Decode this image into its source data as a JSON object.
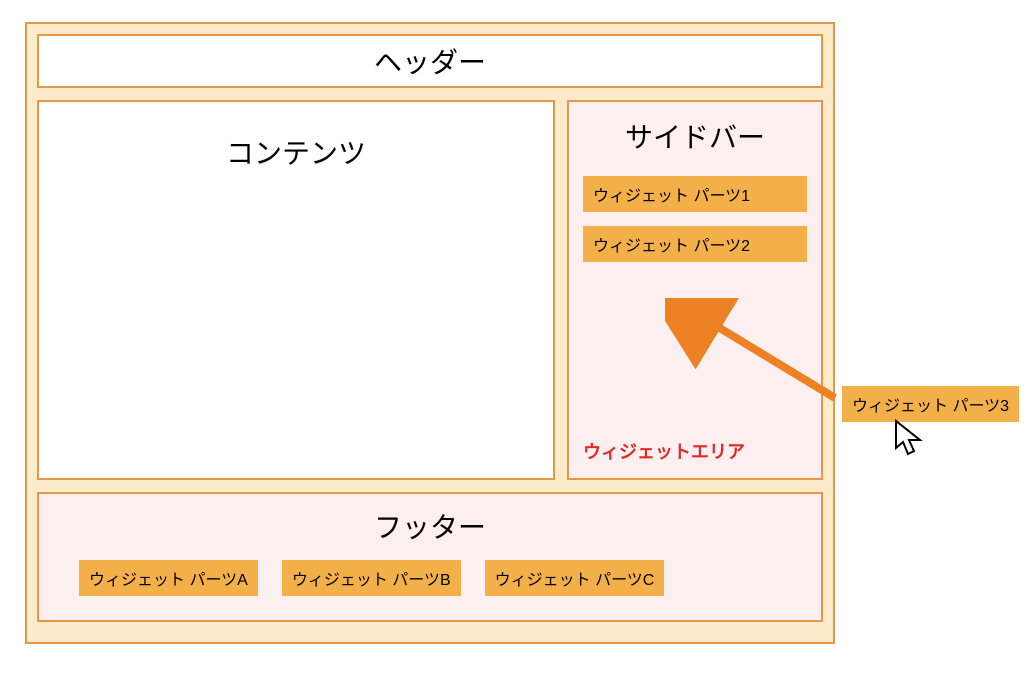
{
  "layout": {
    "header": "ヘッダー",
    "content": "コンテンツ",
    "sidebar": {
      "title": "サイドバー",
      "widgets": [
        "ウィジェット パーツ1",
        "ウィジェット パーツ2"
      ],
      "area_label": "ウィジェットエリア"
    },
    "footer": {
      "title": "フッター",
      "widgets": [
        "ウィジェット パーツA",
        "ウィジェット パーツB",
        "ウィジェット パーツC"
      ]
    }
  },
  "dragging_widget": "ウィジェット パーツ3",
  "colors": {
    "container_bg": "#fcebc9",
    "border": "#e8964a",
    "panel_bg": "#fbeff0",
    "widget_bg": "#f3b048",
    "area_label": "#e32928",
    "arrow": "#ec8224"
  }
}
